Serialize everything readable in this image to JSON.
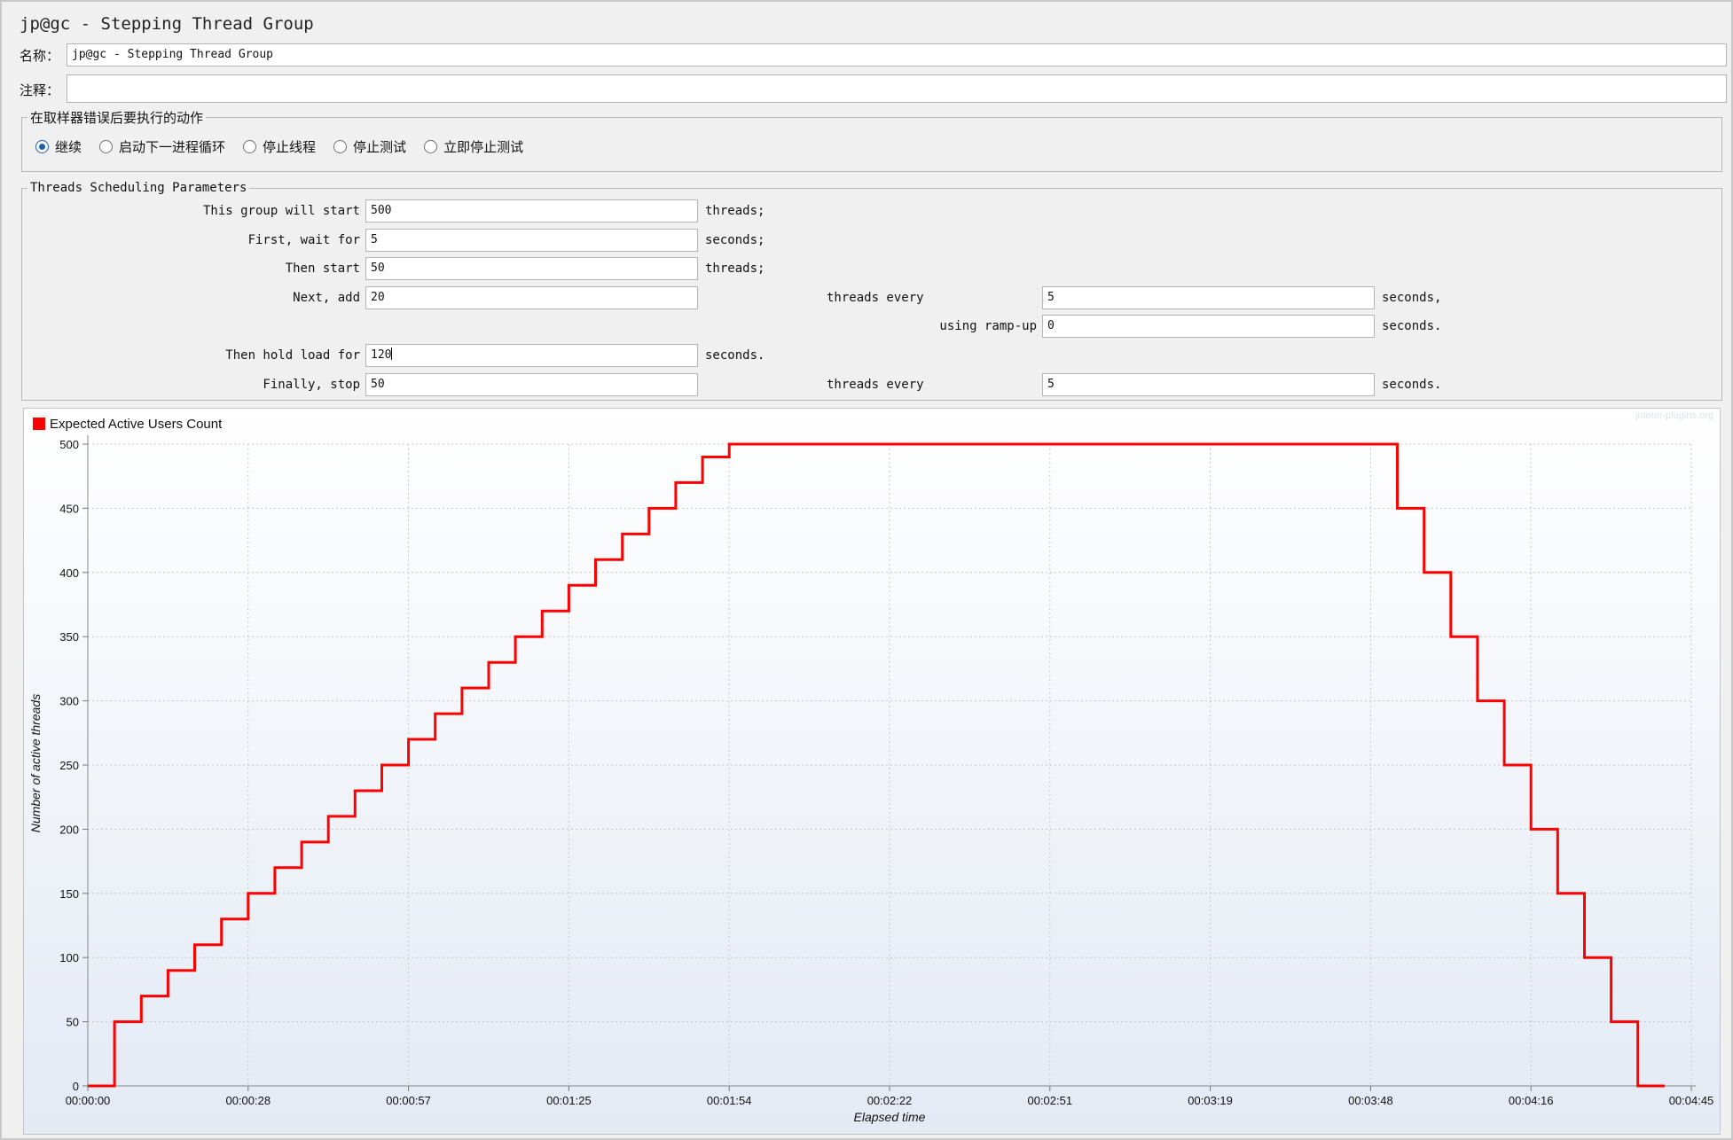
{
  "window": {
    "title": "jp@gc - Stepping Thread Group"
  },
  "name_field": {
    "label": "名称：",
    "value": "jp@gc - Stepping Thread Group"
  },
  "comment_field": {
    "label": "注释：",
    "value": ""
  },
  "error_action": {
    "legend": "在取样器错误后要执行的动作",
    "options": [
      "继续",
      "启动下一进程循环",
      "停止线程",
      "停止测试",
      "立即停止测试"
    ],
    "selected": "继续"
  },
  "scheduling": {
    "legend": "Threads Scheduling Parameters",
    "start_label": "This group will start",
    "start_value": "500",
    "start_unit": "threads;",
    "wait_label": "First, wait for",
    "wait_value": "5",
    "wait_unit": "seconds;",
    "then_start_label": "Then start",
    "then_start_value": "50",
    "then_start_unit": "threads;",
    "add_label": "Next, add",
    "add_value": "20",
    "add_every_label": "threads every",
    "add_every_value": "5",
    "add_every_unit": "seconds,",
    "rampup_label": "using ramp-up",
    "rampup_value": "0",
    "rampup_unit": "seconds.",
    "hold_label": "Then hold load for",
    "hold_value": "120",
    "hold_unit": "seconds.",
    "stop_label": "Finally, stop",
    "stop_value": "50",
    "stop_every_label": "threads every",
    "stop_every_value": "5",
    "stop_every_unit": "seconds."
  },
  "chart_data": {
    "type": "line",
    "legend_label": "Expected Active Users Count",
    "watermark": "jmeter-plugins.org",
    "xlabel": "Elapsed time",
    "ylabel": "Number of active threads",
    "line_color": "#ff0000",
    "ylim": [
      0,
      500
    ],
    "xlim_seconds": [
      0,
      300
    ],
    "y_ticks": [
      0,
      50,
      100,
      150,
      200,
      250,
      300,
      350,
      400,
      450,
      500
    ],
    "x_tick_labels": [
      "00:00:00",
      "00:00:28",
      "00:00:57",
      "00:01:25",
      "00:01:54",
      "00:02:22",
      "00:02:51",
      "00:03:19",
      "00:03:48",
      "00:04:16",
      "00:04:45"
    ],
    "grid": true,
    "series": [
      {
        "name": "Expected Active Users Count",
        "x_seconds": [
          0,
          5,
          5,
          10,
          10,
          15,
          15,
          20,
          20,
          25,
          25,
          30,
          30,
          35,
          35,
          40,
          40,
          45,
          45,
          50,
          50,
          55,
          55,
          60,
          60,
          65,
          65,
          70,
          70,
          75,
          75,
          80,
          80,
          85,
          85,
          90,
          90,
          95,
          95,
          100,
          100,
          105,
          105,
          110,
          110,
          115,
          115,
          120,
          120,
          125,
          125,
          245,
          245,
          250,
          250,
          255,
          255,
          260,
          260,
          265,
          265,
          270,
          270,
          275,
          275,
          280,
          280,
          285,
          285,
          290,
          290,
          295,
          295
        ],
        "y": [
          0,
          0,
          50,
          50,
          70,
          70,
          90,
          90,
          110,
          110,
          130,
          130,
          150,
          150,
          170,
          170,
          190,
          190,
          210,
          210,
          230,
          230,
          250,
          250,
          270,
          270,
          290,
          290,
          310,
          310,
          330,
          330,
          350,
          350,
          370,
          370,
          390,
          390,
          410,
          410,
          430,
          430,
          450,
          450,
          470,
          470,
          490,
          490,
          500,
          500,
          500,
          500,
          450,
          450,
          400,
          400,
          350,
          350,
          300,
          300,
          250,
          250,
          200,
          200,
          150,
          150,
          100,
          100,
          50,
          50,
          0,
          0
        ]
      }
    ]
  }
}
